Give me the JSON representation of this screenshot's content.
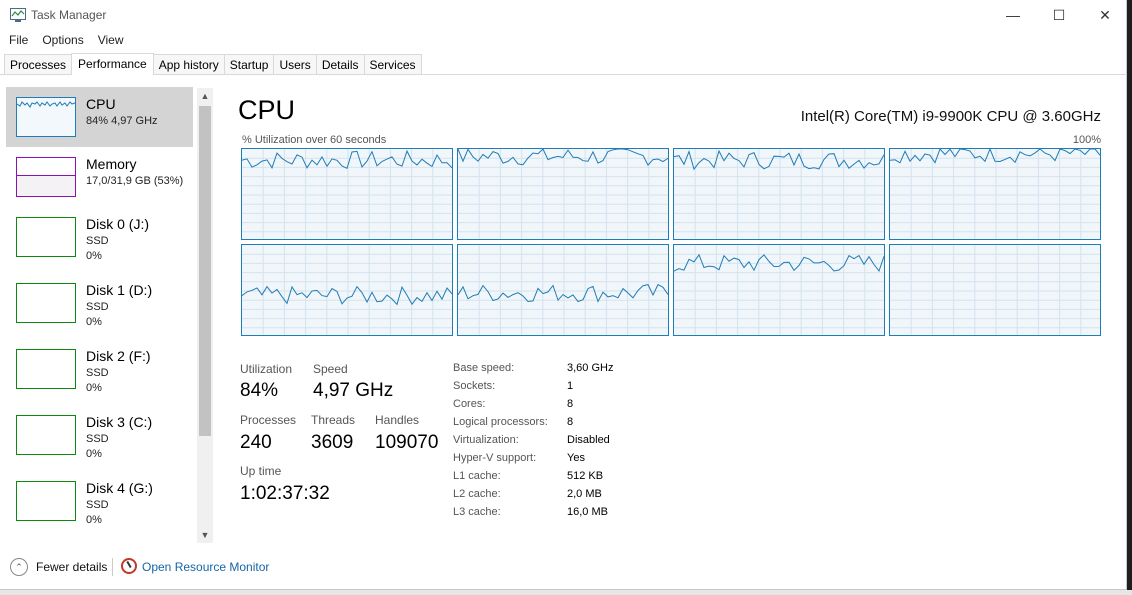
{
  "window": {
    "title": "Task Manager",
    "controls": {
      "minimize": "—",
      "maximize": "☐",
      "close": "✕"
    }
  },
  "menu": [
    "File",
    "Options",
    "View"
  ],
  "tabs": [
    "Processes",
    "Performance",
    "App history",
    "Startup",
    "Users",
    "Details",
    "Services"
  ],
  "active_tab": "Performance",
  "sidebar": {
    "items": [
      {
        "name": "CPU",
        "line1": "84% 4,97 GHz",
        "line2": "",
        "kind": "cpu",
        "selected": true
      },
      {
        "name": "Memory",
        "line1": "17,0/31,9 GB (53%)",
        "line2": "",
        "kind": "mem",
        "selected": false
      },
      {
        "name": "Disk 0 (J:)",
        "line1": "SSD",
        "line2": "0%",
        "kind": "disk",
        "selected": false
      },
      {
        "name": "Disk 1 (D:)",
        "line1": "SSD",
        "line2": "0%",
        "kind": "disk",
        "selected": false
      },
      {
        "name": "Disk 2 (F:)",
        "line1": "SSD",
        "line2": "0%",
        "kind": "disk",
        "selected": false
      },
      {
        "name": "Disk 3 (C:)",
        "line1": "SSD",
        "line2": "0%",
        "kind": "disk",
        "selected": false
      },
      {
        "name": "Disk 4 (G:)",
        "line1": "SSD",
        "line2": "0%",
        "kind": "disk",
        "selected": false
      }
    ],
    "scroll_up": "▲",
    "scroll_down": "▼"
  },
  "main": {
    "title": "CPU",
    "model": "Intel(R) Core(TM) i9-9900K CPU @ 3.60GHz",
    "graph_caption": "% Utilization over 60 seconds",
    "graph_max": "100%",
    "logical_processor_count": 8,
    "graph_levels_pct": [
      88,
      92,
      88,
      95,
      45,
      48,
      80,
      0
    ],
    "stats": {
      "utilization_label": "Utilization",
      "utilization": "84%",
      "speed_label": "Speed",
      "speed": "4,97 GHz",
      "processes_label": "Processes",
      "processes": "240",
      "threads_label": "Threads",
      "threads": "3609",
      "handles_label": "Handles",
      "handles": "109070",
      "uptime_label": "Up time",
      "uptime": "1:02:37:32"
    },
    "specs": [
      {
        "key": "Base speed:",
        "value": "3,60 GHz"
      },
      {
        "key": "Sockets:",
        "value": "1"
      },
      {
        "key": "Cores:",
        "value": "8"
      },
      {
        "key": "Logical processors:",
        "value": "8"
      },
      {
        "key": "Virtualization:",
        "value": "Disabled"
      },
      {
        "key": "Hyper-V support:",
        "value": "Yes"
      },
      {
        "key": "L1 cache:",
        "value": "512 KB"
      },
      {
        "key": "L2 cache:",
        "value": "2,0 MB"
      },
      {
        "key": "L3 cache:",
        "value": "16,0 MB"
      }
    ]
  },
  "footer": {
    "fewer_details": "Fewer details",
    "open_resource_monitor": "Open Resource Monitor",
    "fewer_icon": "⌃"
  },
  "colors": {
    "cpu_line": "#1f7cb4",
    "cpu_fill": "#f1f6fa",
    "memory_accent": "#8b12ae",
    "disk_accent": "#0d8a0d",
    "link": "#1565a8"
  }
}
